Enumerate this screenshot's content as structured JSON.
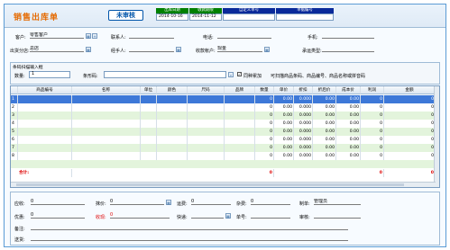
{
  "header": {
    "title": "销售出库单",
    "stamp": "未审核",
    "cols": [
      {
        "label": "出库日期",
        "value": "2014-10-16",
        "color": "#008000"
      },
      {
        "label": "收款期限",
        "value": "2014-11-12",
        "color": "#008000"
      },
      {
        "label": "自定义单号",
        "value": "",
        "color": "#0a2a9a"
      },
      {
        "label": "单据编号",
        "value": "",
        "color": "#0a2a9a"
      }
    ]
  },
  "form": {
    "customer_label": "客户:",
    "customer_value": "零售客户",
    "contact_label": "联系人:",
    "contact_value": "",
    "phone_label": "电话:",
    "phone_value": "",
    "mobile_label": "手机:",
    "mobile_value": "",
    "warehouse_label": "出货分店:",
    "warehouse_value": "总店",
    "handler_label": "经手人:",
    "handler_value": "",
    "account_label": "收款帐户:",
    "account_value": "现金",
    "carrier_label": "承运类型:",
    "carrier_value": ""
  },
  "scan": {
    "title": "条码扫描输入框",
    "qty_label": "数量:",
    "qty_value": "1",
    "barcode_label": "条形码:",
    "barcode_value": "",
    "same_add_label": "同种累加",
    "hint": "可扫描商品条码、商品编号、商品名称或拼音码"
  },
  "grid": {
    "headers": [
      "",
      "商品编号",
      "名称",
      "单位",
      "颜色",
      "尺码",
      "品牌",
      "数量",
      "单价",
      "折扣",
      "折后价",
      "成本价",
      "利润",
      "金额"
    ],
    "rows": [
      {
        "n": "1",
        "qty": "0",
        "price": "0.00",
        "disc": "0.000",
        "aprice": "0.00",
        "cost": "0.00",
        "profit": "0",
        "amount": "0"
      },
      {
        "n": "2",
        "qty": "0",
        "price": "0.00",
        "disc": "0.000",
        "aprice": "0.00",
        "cost": "0.00",
        "profit": "0",
        "amount": "0"
      },
      {
        "n": "3",
        "qty": "0",
        "price": "0.00",
        "disc": "0.000",
        "aprice": "0.00",
        "cost": "0.00",
        "profit": "0",
        "amount": "0"
      },
      {
        "n": "4",
        "qty": "0",
        "price": "0.00",
        "disc": "0.000",
        "aprice": "0.00",
        "cost": "0.00",
        "profit": "0",
        "amount": "0"
      },
      {
        "n": "5",
        "qty": "0",
        "price": "0.00",
        "disc": "0.000",
        "aprice": "0.00",
        "cost": "0.00",
        "profit": "0",
        "amount": "0"
      },
      {
        "n": "6",
        "qty": "0",
        "price": "0.00",
        "disc": "0.000",
        "aprice": "0.00",
        "cost": "0.00",
        "profit": "0",
        "amount": "0"
      },
      {
        "n": "7",
        "qty": "0",
        "price": "0.00",
        "disc": "0.000",
        "aprice": "0.00",
        "cost": "0.00",
        "profit": "0",
        "amount": "0"
      },
      {
        "n": "8",
        "qty": "0",
        "price": "0.00",
        "disc": "0.000",
        "aprice": "0.00",
        "cost": "0.00",
        "profit": "0",
        "amount": "0"
      }
    ],
    "total_label": "合计:",
    "total": {
      "qty": "0",
      "profit": "0",
      "amount": "0"
    }
  },
  "footer": {
    "received_label": "应收:",
    "received_value": "0",
    "discount_label": "抹价:",
    "discount_value": "0",
    "freight_label": "运费:",
    "freight_value": "0",
    "misc_label": "杂费:",
    "misc_value": "0",
    "maker_label": "制单:",
    "maker_value": "管理员",
    "promo_label": "优惠:",
    "promo_value": "0",
    "collect_label": "收现:",
    "collect_value": "0",
    "express_label": "快递:",
    "express_value": "",
    "waybill_label": "单号:",
    "waybill_value": "",
    "audit_label": "审核:",
    "audit_value": "",
    "remark_label": "备注:",
    "remark_value": "",
    "address_label": "送货:",
    "address_value": ""
  }
}
